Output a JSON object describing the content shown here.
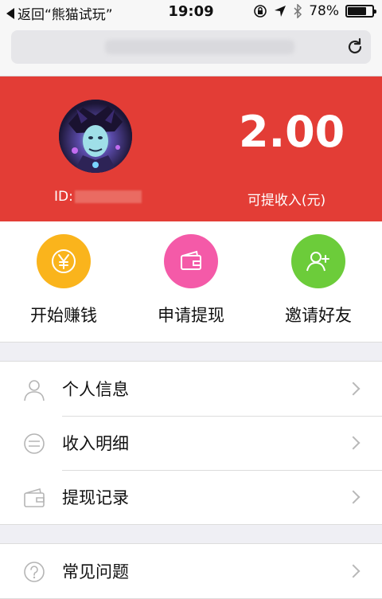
{
  "status_bar": {
    "back_label": "返回“熊猫试玩”",
    "time": "19:09",
    "battery_percent": "78%",
    "battery_level": 0.78
  },
  "profile": {
    "id_label": "ID:",
    "amount": "2.00",
    "amount_label": "可提收入(元)"
  },
  "actions": [
    {
      "label": "开始赚钱",
      "icon": "yen-icon",
      "color": "#fab41c"
    },
    {
      "label": "申请提现",
      "icon": "wallet-icon",
      "color": "#f45aa8"
    },
    {
      "label": "邀请好友",
      "icon": "add-person-icon",
      "color": "#6ccc3a"
    }
  ],
  "menu": [
    {
      "label": "个人信息",
      "icon": "person-icon"
    },
    {
      "label": "收入明细",
      "icon": "list-icon"
    },
    {
      "label": "提现记录",
      "icon": "wallet-icon"
    }
  ],
  "menu2": [
    {
      "label": "常见问题",
      "icon": "question-icon"
    }
  ],
  "colors": {
    "header": "#e33d36"
  }
}
